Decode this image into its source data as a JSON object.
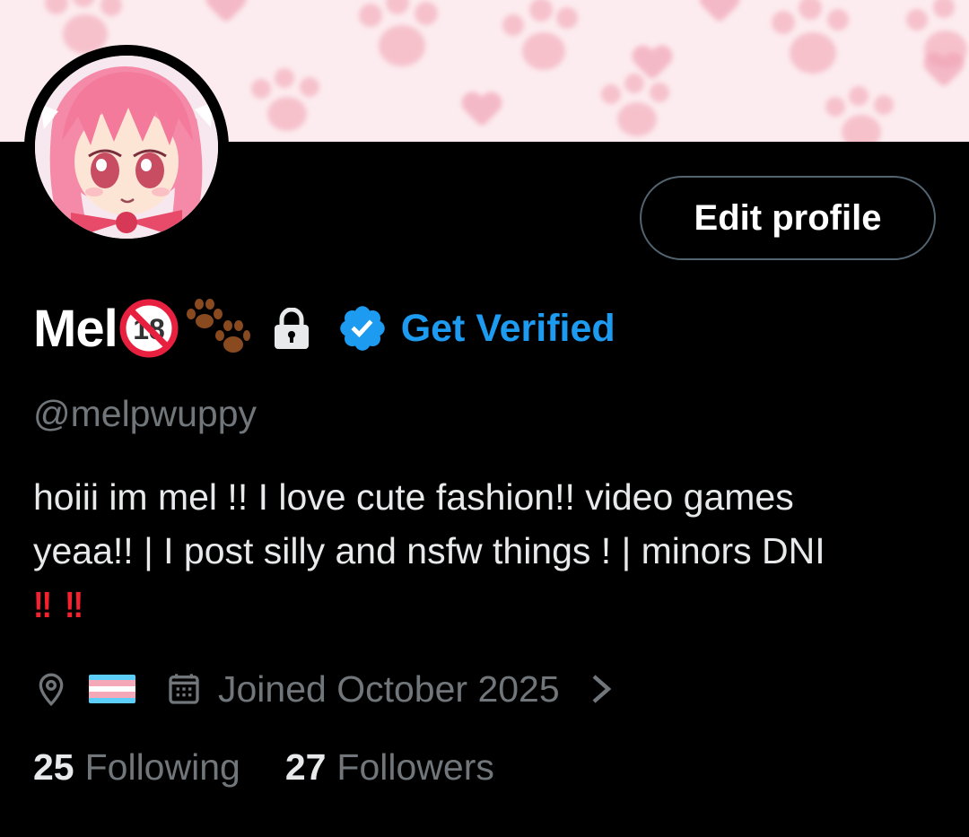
{
  "profile": {
    "edit_button_label": "Edit profile",
    "display_name": "Mel",
    "get_verified_label": "Get Verified",
    "handle": "@melpwuppy",
    "bio_line1": "hoiii im mel !! I love cute fashion!! video games",
    "bio_line2": "yeaa!! | I post silly and nsfw things ! | minors DNI",
    "bio_line3_emoji": [
      "‼",
      "‼"
    ],
    "location_flag": "transgender-flag",
    "joined": "Joined October 2025",
    "following_count": "25",
    "following_label": "Following",
    "followers_count": "27",
    "followers_label": "Followers"
  },
  "colors": {
    "background": "#000000",
    "accent": "#1d9bf0",
    "secondary_text": "#71767b",
    "primary_text": "#e7e9ea",
    "banner": "#fcecef",
    "trans_flag": [
      "#5bcefa",
      "#f5a9b8",
      "#ffffff",
      "#f5a9b8",
      "#5bcefa"
    ]
  },
  "icons": {
    "age_badge": "no-under-18-icon",
    "paws": "paw-prints-icon",
    "protected": "lock-icon",
    "verified": "verified-badge-icon",
    "location": "location-pin-icon",
    "calendar": "calendar-icon",
    "chevron": "chevron-right-icon"
  }
}
